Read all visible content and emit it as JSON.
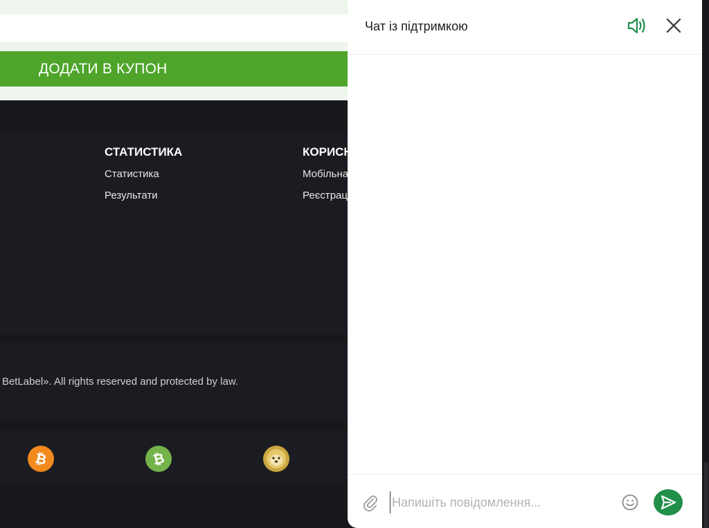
{
  "page": {
    "coupon_button": "ДОДАТИ В КУПОН",
    "footer": {
      "statistics": {
        "title": "СТАТИСТИКА",
        "links": [
          "Статистика",
          "Результати"
        ]
      },
      "useful": {
        "title": "КОРИСН",
        "links": [
          "Мобільна",
          "Реєстрац"
        ]
      }
    },
    "copyright": "BetLabel». All rights reserved and protected by law.",
    "crypto_icons": [
      "bitcoin-icon",
      "bitcoin-cash-icon",
      "dogecoin-icon"
    ],
    "accent_color": "#4ea52a"
  },
  "chat": {
    "title": "Чат із підтримкою",
    "input_placeholder": "Напишіть повідомлення...",
    "icons": [
      "sound-icon",
      "close-icon",
      "paperclip-icon",
      "emoji-icon",
      "send-icon"
    ],
    "accent_color": "#1f8f4a"
  }
}
